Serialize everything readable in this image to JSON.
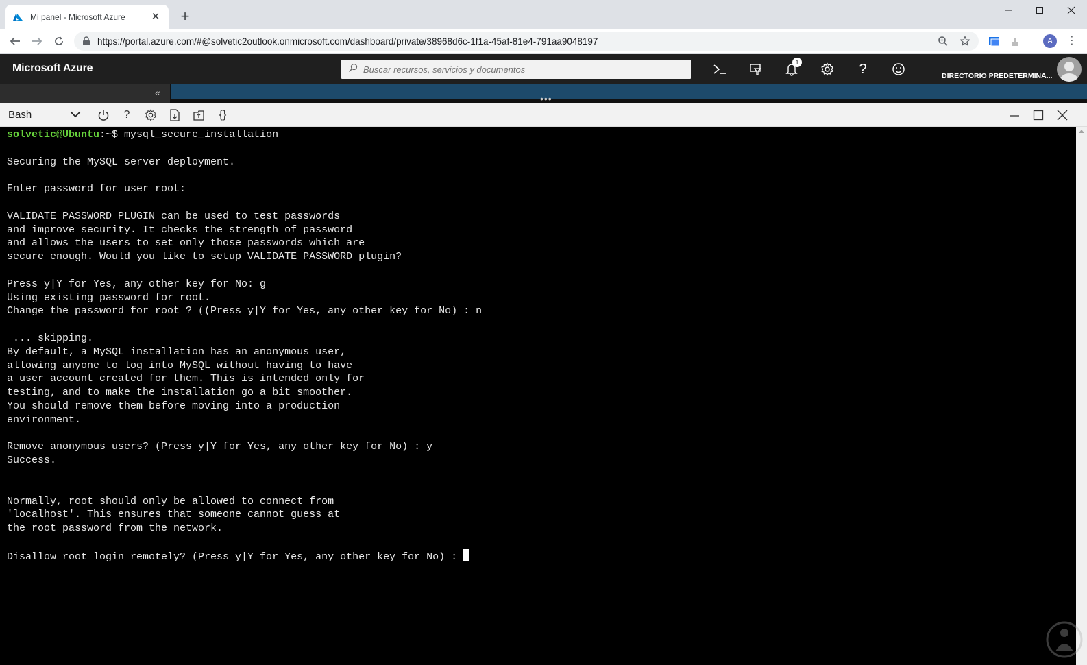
{
  "browser": {
    "tab_title": "Mi panel - Microsoft Azure",
    "url": "https://portal.azure.com/#@solvetic2outlook.onmicrosoft.com/dashboard/private/38968d6c-1f1a-45af-81e4-791aa9048197",
    "profile_initial": "A"
  },
  "azure": {
    "brand": "Microsoft Azure",
    "search_placeholder": "Buscar recursos, servicios y documentos",
    "notification_count": "1",
    "directory": "DIRECTORIO PREDETERMINA...",
    "collapse_glyph": "«",
    "more_glyph": "•••"
  },
  "shell": {
    "selected_shell": "Bash"
  },
  "terminal": {
    "prompt_user": "solvetic@Ubuntu",
    "prompt_sep": ":~$ ",
    "command": "mysql_secure_installation",
    "lines": [
      "",
      "Securing the MySQL server deployment.",
      "",
      "Enter password for user root:",
      "",
      "VALIDATE PASSWORD PLUGIN can be used to test passwords",
      "and improve security. It checks the strength of password",
      "and allows the users to set only those passwords which are",
      "secure enough. Would you like to setup VALIDATE PASSWORD plugin?",
      "",
      "Press y|Y for Yes, any other key for No: g",
      "Using existing password for root.",
      "Change the password for root ? ((Press y|Y for Yes, any other key for No) : n",
      "",
      " ... skipping.",
      "By default, a MySQL installation has an anonymous user,",
      "allowing anyone to log into MySQL without having to have",
      "a user account created for them. This is intended only for",
      "testing, and to make the installation go a bit smoother.",
      "You should remove them before moving into a production",
      "environment.",
      "",
      "Remove anonymous users? (Press y|Y for Yes, any other key for No) : y",
      "Success.",
      "",
      "",
      "Normally, root should only be allowed to connect from",
      "'localhost'. This ensures that someone cannot guess at",
      "the root password from the network.",
      ""
    ],
    "current_line": "Disallow root login remotely? (Press y|Y for Yes, any other key for No) : "
  },
  "colors": {
    "prompt": "#66d13b",
    "azure_header": "#1f1f1f",
    "terminal_bg": "#000000"
  }
}
